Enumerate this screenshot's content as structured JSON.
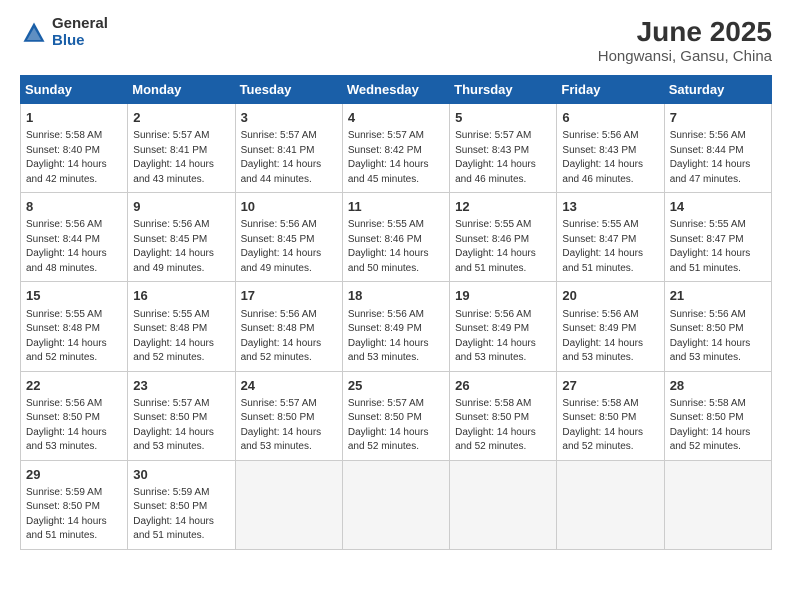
{
  "logo": {
    "general": "General",
    "blue": "Blue"
  },
  "title": {
    "month": "June 2025",
    "location": "Hongwansi, Gansu, China"
  },
  "weekdays": [
    "Sunday",
    "Monday",
    "Tuesday",
    "Wednesday",
    "Thursday",
    "Friday",
    "Saturday"
  ],
  "weeks": [
    [
      {
        "day": "1",
        "info": "Sunrise: 5:58 AM\nSunset: 8:40 PM\nDaylight: 14 hours\nand 42 minutes."
      },
      {
        "day": "2",
        "info": "Sunrise: 5:57 AM\nSunset: 8:41 PM\nDaylight: 14 hours\nand 43 minutes."
      },
      {
        "day": "3",
        "info": "Sunrise: 5:57 AM\nSunset: 8:41 PM\nDaylight: 14 hours\nand 44 minutes."
      },
      {
        "day": "4",
        "info": "Sunrise: 5:57 AM\nSunset: 8:42 PM\nDaylight: 14 hours\nand 45 minutes."
      },
      {
        "day": "5",
        "info": "Sunrise: 5:57 AM\nSunset: 8:43 PM\nDaylight: 14 hours\nand 46 minutes."
      },
      {
        "day": "6",
        "info": "Sunrise: 5:56 AM\nSunset: 8:43 PM\nDaylight: 14 hours\nand 46 minutes."
      },
      {
        "day": "7",
        "info": "Sunrise: 5:56 AM\nSunset: 8:44 PM\nDaylight: 14 hours\nand 47 minutes."
      }
    ],
    [
      {
        "day": "8",
        "info": "Sunrise: 5:56 AM\nSunset: 8:44 PM\nDaylight: 14 hours\nand 48 minutes."
      },
      {
        "day": "9",
        "info": "Sunrise: 5:56 AM\nSunset: 8:45 PM\nDaylight: 14 hours\nand 49 minutes."
      },
      {
        "day": "10",
        "info": "Sunrise: 5:56 AM\nSunset: 8:45 PM\nDaylight: 14 hours\nand 49 minutes."
      },
      {
        "day": "11",
        "info": "Sunrise: 5:55 AM\nSunset: 8:46 PM\nDaylight: 14 hours\nand 50 minutes."
      },
      {
        "day": "12",
        "info": "Sunrise: 5:55 AM\nSunset: 8:46 PM\nDaylight: 14 hours\nand 51 minutes."
      },
      {
        "day": "13",
        "info": "Sunrise: 5:55 AM\nSunset: 8:47 PM\nDaylight: 14 hours\nand 51 minutes."
      },
      {
        "day": "14",
        "info": "Sunrise: 5:55 AM\nSunset: 8:47 PM\nDaylight: 14 hours\nand 51 minutes."
      }
    ],
    [
      {
        "day": "15",
        "info": "Sunrise: 5:55 AM\nSunset: 8:48 PM\nDaylight: 14 hours\nand 52 minutes."
      },
      {
        "day": "16",
        "info": "Sunrise: 5:55 AM\nSunset: 8:48 PM\nDaylight: 14 hours\nand 52 minutes."
      },
      {
        "day": "17",
        "info": "Sunrise: 5:56 AM\nSunset: 8:48 PM\nDaylight: 14 hours\nand 52 minutes."
      },
      {
        "day": "18",
        "info": "Sunrise: 5:56 AM\nSunset: 8:49 PM\nDaylight: 14 hours\nand 53 minutes."
      },
      {
        "day": "19",
        "info": "Sunrise: 5:56 AM\nSunset: 8:49 PM\nDaylight: 14 hours\nand 53 minutes."
      },
      {
        "day": "20",
        "info": "Sunrise: 5:56 AM\nSunset: 8:49 PM\nDaylight: 14 hours\nand 53 minutes."
      },
      {
        "day": "21",
        "info": "Sunrise: 5:56 AM\nSunset: 8:50 PM\nDaylight: 14 hours\nand 53 minutes."
      }
    ],
    [
      {
        "day": "22",
        "info": "Sunrise: 5:56 AM\nSunset: 8:50 PM\nDaylight: 14 hours\nand 53 minutes."
      },
      {
        "day": "23",
        "info": "Sunrise: 5:57 AM\nSunset: 8:50 PM\nDaylight: 14 hours\nand 53 minutes."
      },
      {
        "day": "24",
        "info": "Sunrise: 5:57 AM\nSunset: 8:50 PM\nDaylight: 14 hours\nand 53 minutes."
      },
      {
        "day": "25",
        "info": "Sunrise: 5:57 AM\nSunset: 8:50 PM\nDaylight: 14 hours\nand 52 minutes."
      },
      {
        "day": "26",
        "info": "Sunrise: 5:58 AM\nSunset: 8:50 PM\nDaylight: 14 hours\nand 52 minutes."
      },
      {
        "day": "27",
        "info": "Sunrise: 5:58 AM\nSunset: 8:50 PM\nDaylight: 14 hours\nand 52 minutes."
      },
      {
        "day": "28",
        "info": "Sunrise: 5:58 AM\nSunset: 8:50 PM\nDaylight: 14 hours\nand 52 minutes."
      }
    ],
    [
      {
        "day": "29",
        "info": "Sunrise: 5:59 AM\nSunset: 8:50 PM\nDaylight: 14 hours\nand 51 minutes."
      },
      {
        "day": "30",
        "info": "Sunrise: 5:59 AM\nSunset: 8:50 PM\nDaylight: 14 hours\nand 51 minutes."
      },
      {
        "day": "",
        "info": ""
      },
      {
        "day": "",
        "info": ""
      },
      {
        "day": "",
        "info": ""
      },
      {
        "day": "",
        "info": ""
      },
      {
        "day": "",
        "info": ""
      }
    ]
  ]
}
